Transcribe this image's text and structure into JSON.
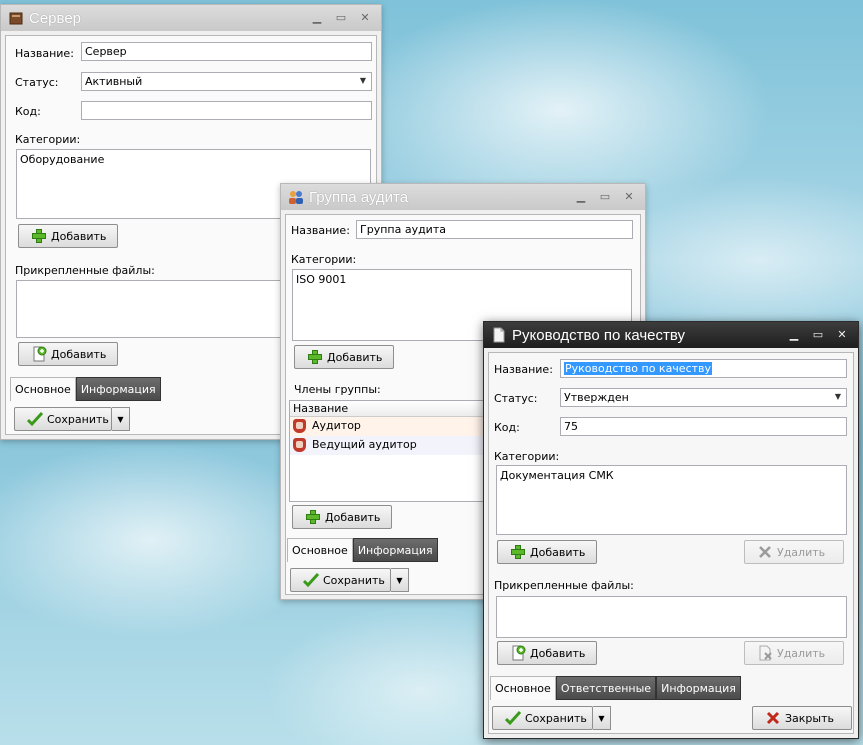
{
  "server": {
    "title": "Сервер",
    "name_label": "Название:",
    "name_value": "Сервер",
    "status_label": "Статус:",
    "status_value": "Активный",
    "code_label": "Код:",
    "code_value": "",
    "categories_label": "Категории:",
    "categories": [
      "Оборудование"
    ],
    "add_category": "Добавить",
    "files_label": "Прикрепленные файлы:",
    "add_file": "Добавить",
    "tabs": [
      "Основное",
      "Информация"
    ],
    "save": "Сохранить"
  },
  "audit": {
    "title": "Группа аудита",
    "name_label": "Название:",
    "name_value": "Группа аудита",
    "categories_label": "Категории:",
    "categories": [
      "ISO 9001"
    ],
    "add_category": "Добавить",
    "members_label": "Члены группы:",
    "members_header": "Название",
    "members": [
      "Аудитор",
      "Ведущий аудитор"
    ],
    "add_member": "Добавить",
    "tabs": [
      "Основное",
      "Информация"
    ],
    "save": "Сохранить"
  },
  "manual": {
    "title": "Руководство по качеству",
    "name_label": "Название:",
    "name_value": "Руководство по качеству",
    "status_label": "Статус:",
    "status_value": "Утвержден",
    "code_label": "Код:",
    "code_value": "75",
    "categories_label": "Категории:",
    "categories": [
      "Документация СМК"
    ],
    "add_category": "Добавить",
    "delete_category": "Удалить",
    "files_label": "Прикрепленные файлы:",
    "add_file": "Добавить",
    "delete_file": "Удалить",
    "tabs": [
      "Основное",
      "Ответственные",
      "Информация"
    ],
    "save": "Сохранить",
    "close": "Закрыть"
  }
}
